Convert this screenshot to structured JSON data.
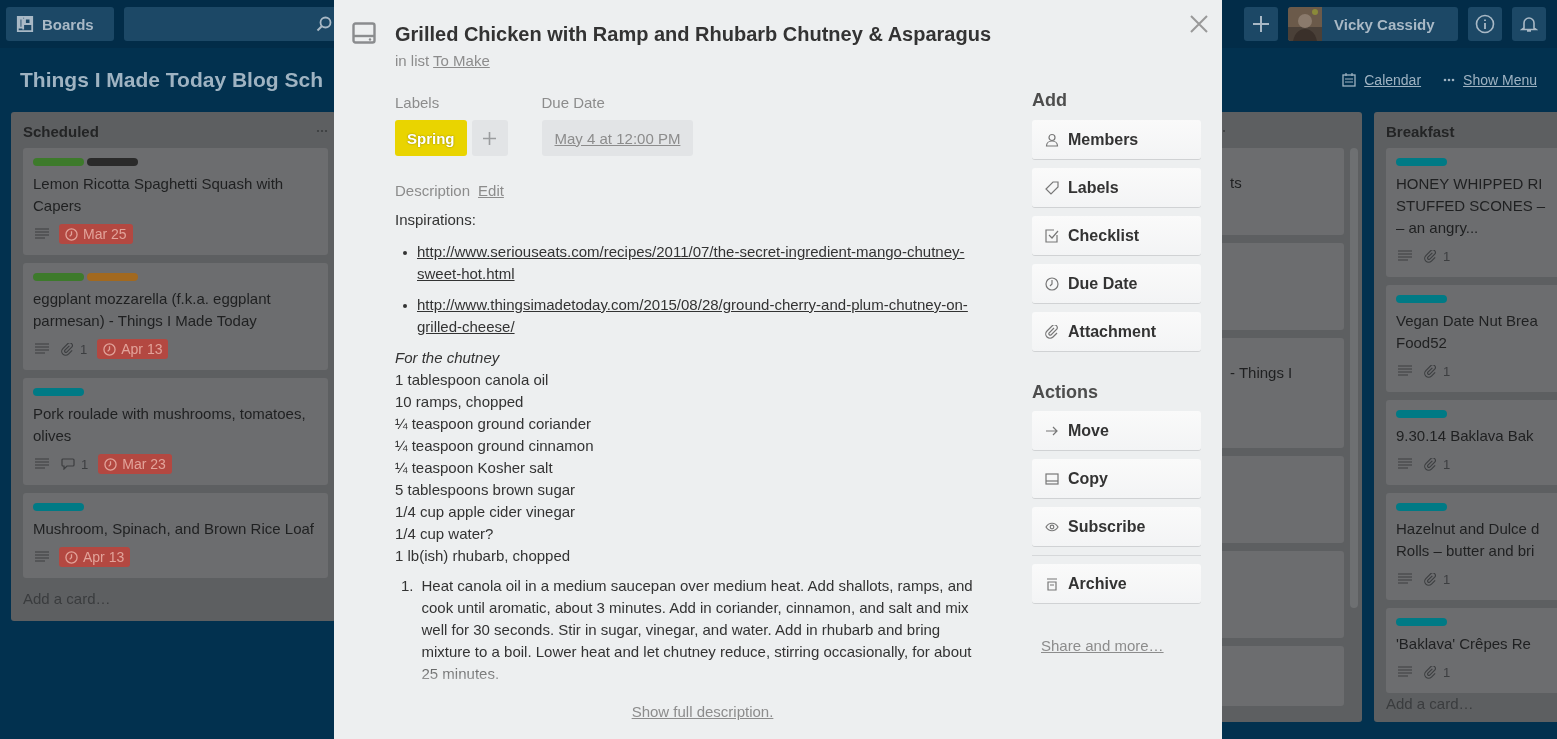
{
  "header": {
    "boards_button": "Boards",
    "user_name": "Vicky Cassidy"
  },
  "board": {
    "title": "Things I Made Today Blog Sch",
    "calendar": "Calendar",
    "show_menu": "Show Menu"
  },
  "lists": [
    {
      "title": "Scheduled",
      "add_card": "Add a card…",
      "cards": [
        {
          "labels": [
            {
              "color": "#3d7a2b"
            },
            {
              "color": "#2a2a2a"
            }
          ],
          "title": "Lemon Ricotta Spaghetti Squash with Capers",
          "badges": [
            {
              "kind": "description"
            },
            {
              "kind": "due",
              "text": "Mar 25"
            }
          ]
        },
        {
          "labels": [
            {
              "color": "#3d7a2b"
            },
            {
              "color": "#a2691f"
            }
          ],
          "title": "eggplant mozzarella (f.k.a. eggplant parmesan) - Things I Made Today",
          "badges": [
            {
              "kind": "description"
            },
            {
              "kind": "attachments",
              "count": "1"
            },
            {
              "kind": "due",
              "text": "Apr 13"
            }
          ]
        },
        {
          "labels": [
            {
              "color": "#007a85"
            }
          ],
          "title": "Pork roulade with mushrooms, tomatoes, olives",
          "badges": [
            {
              "kind": "description"
            },
            {
              "kind": "comments",
              "count": "1"
            },
            {
              "kind": "due",
              "text": "Mar 23"
            }
          ]
        },
        {
          "labels": [
            {
              "color": "#007a85"
            }
          ],
          "title": "Mushroom, Spinach, and Brown Rice Loaf",
          "badges": [
            {
              "kind": "description"
            },
            {
              "kind": "due",
              "text": "Apr 13"
            }
          ]
        }
      ]
    },
    {
      "cards": [
        {
          "kind": "text",
          "title": "ts"
        },
        {
          "kind": "blank"
        },
        {
          "kind": "text",
          "title": "- Things I"
        },
        {
          "kind": "blank"
        },
        {
          "kind": "blank"
        },
        {
          "kind": "blank"
        }
      ]
    },
    {
      "title": "Breakfast",
      "add_card": "Add a card…",
      "cards": [
        {
          "labels": [
            {
              "color": "#007a85"
            }
          ],
          "title": "HONEY WHIPPED RI\nSTUFFED SCONES –\n– an angry...",
          "badges": [
            {
              "kind": "description"
            },
            {
              "kind": "attachments",
              "count": "1"
            }
          ]
        },
        {
          "labels": [
            {
              "color": "#007a85"
            }
          ],
          "title": "Vegan Date Nut Brea\nFood52",
          "badges": [
            {
              "kind": "description"
            },
            {
              "kind": "attachments",
              "count": "1"
            }
          ]
        },
        {
          "labels": [
            {
              "color": "#007a85"
            }
          ],
          "title": "9.30.14 Baklava Bak",
          "badges": [
            {
              "kind": "description"
            },
            {
              "kind": "attachments",
              "count": "1"
            }
          ]
        },
        {
          "labels": [
            {
              "color": "#007a85"
            }
          ],
          "title": "Hazelnut and Dulce d\nRolls – butter and bri",
          "badges": [
            {
              "kind": "description"
            },
            {
              "kind": "attachments",
              "count": "1"
            }
          ]
        },
        {
          "labels": [
            {
              "color": "#007a85"
            }
          ],
          "title": "'Baklava' Crêpes Re",
          "badges": [
            {
              "kind": "description"
            },
            {
              "kind": "attachments",
              "count": "1"
            }
          ]
        }
      ]
    }
  ],
  "card_detail": {
    "title": "Grilled Chicken with Ramp and Rhubarb Chutney & Asparagus",
    "list_prefix": "in list",
    "list_name": "To Make",
    "labels_heading": "Labels",
    "labels": [
      {
        "text": "Spring",
        "color": "#e9d400"
      }
    ],
    "due_heading": "Due Date",
    "due": "May 4 at 12:00 PM",
    "description_heading": "Description",
    "edit": "Edit",
    "intro": "Inspirations:",
    "links": [
      "http://www.seriouseats.com/recipes/2011/07/the-secret-ingredient-mango-chutney-sweet-hot.html",
      "http://www.thingsimadetoday.com/2015/08/28/ground-cherry-and-plum-chutney-on-grilled-cheese/"
    ],
    "subheading": "For the chutney",
    "ingredients": [
      "1 tablespoon canola oil",
      "10 ramps, chopped",
      "¼ teaspoon ground coriander",
      "¼ teaspoon ground cinnamon",
      "¼ teaspoon Kosher salt",
      "5 tablespoons brown sugar",
      "1/4 cup apple cider vinegar",
      "1/4 cup water?",
      "1 lb(ish) rhubarb, chopped"
    ],
    "steps": [
      {
        "number": "1.",
        "text": "Heat canola oil in a medium saucepan over medium heat. Add shallots, ramps, and cook until aromatic, about 3 minutes. Add in coriander, cinnamon, and salt and mix well for 30 seconds. Stir in sugar, vinegar, and water. Add in rhubarb and bring mixture to a boil. Lower heat and let chutney reduce, stirring occasionally, for about 25 minutes."
      }
    ],
    "show_full": "Show full description.",
    "add_heading": "Add",
    "add_buttons": [
      {
        "kind": "person",
        "label": "Members"
      },
      {
        "kind": "tag",
        "label": "Labels"
      },
      {
        "kind": "checklist",
        "label": "Checklist"
      },
      {
        "kind": "clock",
        "label": "Due Date"
      },
      {
        "kind": "paperclip",
        "label": "Attachment"
      }
    ],
    "actions_heading": "Actions",
    "action_buttons": [
      {
        "kind": "arrow",
        "label": "Move"
      },
      {
        "kind": "card",
        "label": "Copy"
      },
      {
        "kind": "eye",
        "label": "Subscribe"
      },
      {
        "kind": "divider"
      },
      {
        "kind": "archive",
        "label": "Archive"
      }
    ],
    "share": "Share and more…"
  }
}
